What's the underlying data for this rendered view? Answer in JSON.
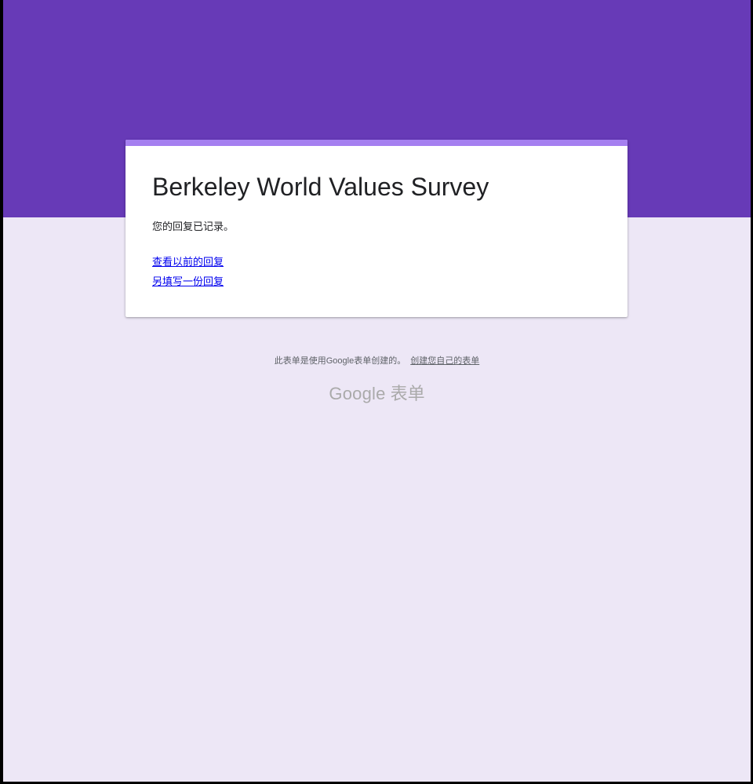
{
  "form": {
    "title": "Berkeley World Values Survey",
    "confirmation_message": "您的回复已记录。",
    "links": {
      "view_previous": "查看以前的回复",
      "submit_another": "另填写一份回复"
    }
  },
  "footer": {
    "note": "此表单是使用Google表单创建的。",
    "create_link": "创建您自己的表单",
    "brand_google": "Google",
    "brand_product": "表单"
  },
  "colors": {
    "header_band": "#673ab7",
    "card_accent": "#a57ff0",
    "page_background": "#ede7f6",
    "link": "#0000ee"
  }
}
